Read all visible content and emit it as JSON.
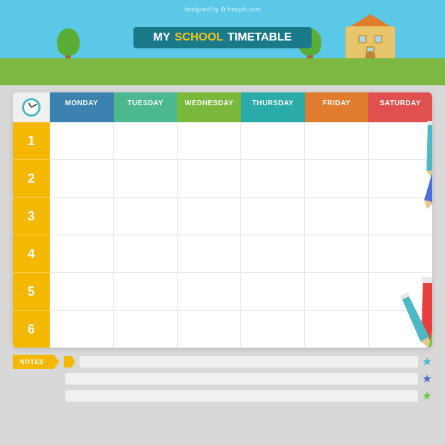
{
  "watermark": "designed by ✿ freepik.com",
  "header": {
    "title_my": "MY",
    "title_school": "SCHOOL",
    "title_timetable": "TIMETABLE"
  },
  "days": [
    {
      "id": "monday",
      "label": "MONDAY",
      "class": "day-monday"
    },
    {
      "id": "tuesday",
      "label": "TUESDAY",
      "class": "day-tuesday"
    },
    {
      "id": "wednesday",
      "label": "WEDNESDAY",
      "class": "day-wednesday"
    },
    {
      "id": "thursday",
      "label": "THURSDAY",
      "class": "day-thursday"
    },
    {
      "id": "friday",
      "label": "FRIDAY",
      "class": "day-friday"
    },
    {
      "id": "saturday",
      "label": "SATURDAY",
      "class": "day-saturday"
    }
  ],
  "rows": [
    1,
    2,
    3,
    4,
    5,
    6
  ],
  "notes": {
    "label": "NOTES",
    "stars": [
      "★",
      "★",
      "★"
    ],
    "star_colors": [
      "#4cb8d0",
      "#5070d0",
      "#70c840"
    ]
  }
}
